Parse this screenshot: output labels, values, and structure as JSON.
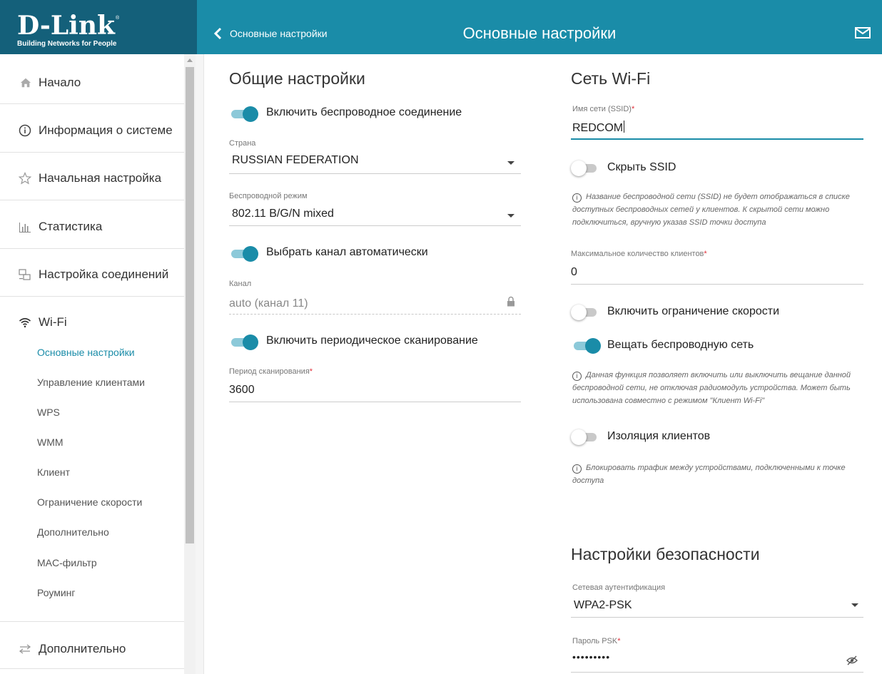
{
  "brand": {
    "logo": "D-Link",
    "registered": "®",
    "tagline": "Building Networks for People"
  },
  "topbar": {
    "back_label": "Основные настройки",
    "title": "Основные настройки",
    "mail_icon": "envelope-icon"
  },
  "colors": {
    "accent": "#1a8ca8",
    "logo_bg": "#14607a",
    "required": "#e0303a"
  },
  "sidebar": {
    "items": [
      {
        "label": "Начало",
        "icon": "home-icon"
      },
      {
        "label": "Информация о системе",
        "icon": "info-icon"
      },
      {
        "label": "Начальная настройка",
        "icon": "star-icon"
      },
      {
        "label": "Статистика",
        "icon": "bar-chart-icon"
      },
      {
        "label": "Настройка соединений",
        "icon": "network-icon"
      },
      {
        "label": "Wi-Fi",
        "icon": "wifi-icon"
      },
      {
        "label": "Дополнительно",
        "icon": "arrows-icon"
      }
    ],
    "wifi_subitems": [
      {
        "label": "Основные настройки",
        "active": true
      },
      {
        "label": "Управление клиентами"
      },
      {
        "label": "WPS"
      },
      {
        "label": "WMM"
      },
      {
        "label": "Клиент"
      },
      {
        "label": "Ограничение скорости"
      },
      {
        "label": "Дополнительно"
      },
      {
        "label": "MAC-фильтр"
      },
      {
        "label": "Роуминг"
      }
    ]
  },
  "general": {
    "title": "Общие настройки",
    "enable_wireless": {
      "label": "Включить беспроводное соединение",
      "on": true
    },
    "country": {
      "label": "Страна",
      "value": "RUSSIAN FEDERATION"
    },
    "mode": {
      "label": "Беспроводной режим",
      "value": "802.11 B/G/N mixed"
    },
    "auto_channel": {
      "label": "Выбрать канал автоматически",
      "on": true
    },
    "channel": {
      "label": "Канал",
      "value": "auto (канал 11)"
    },
    "periodic_scan": {
      "label": "Включить периодическое сканирование",
      "on": true
    },
    "scan_period": {
      "label": "Период сканирования",
      "required": "*",
      "value": "3600"
    }
  },
  "wifi": {
    "title": "Сеть Wi-Fi",
    "ssid": {
      "label": "Имя сети (SSID)",
      "required": "*",
      "value": "REDCOM"
    },
    "hide_ssid": {
      "label": "Скрыть SSID",
      "on": false
    },
    "hide_ssid_hint": "Название беспроводной сети (SSID) не будет отображаться в списке доступных беспроводных сетей у клиентов. К скрытой сети можно подключиться, вручную указав SSID точки доступа",
    "max_clients": {
      "label": "Максимальное количество клиентов",
      "required": "*",
      "value": "0"
    },
    "speed_limit": {
      "label": "Включить ограничение скорости",
      "on": false
    },
    "broadcast": {
      "label": "Вещать беспроводную сеть",
      "on": true
    },
    "broadcast_hint": "Данная функция позволяет включить или выключить вещание данной беспроводной сети, не отключая радиомодуль устройства. Может быть использована совместно с режимом \"Клиент Wi-Fi\"",
    "isolation": {
      "label": "Изоляция клиентов",
      "on": false
    },
    "isolation_hint": "Блокировать трафик между устройствами, подключенными к точке доступа"
  },
  "security": {
    "title": "Настройки безопасности",
    "auth": {
      "label": "Сетевая аутентификация",
      "value": "WPA2-PSK"
    },
    "psk": {
      "label": "Пароль PSK",
      "required": "*",
      "value": "•••••••••"
    }
  }
}
